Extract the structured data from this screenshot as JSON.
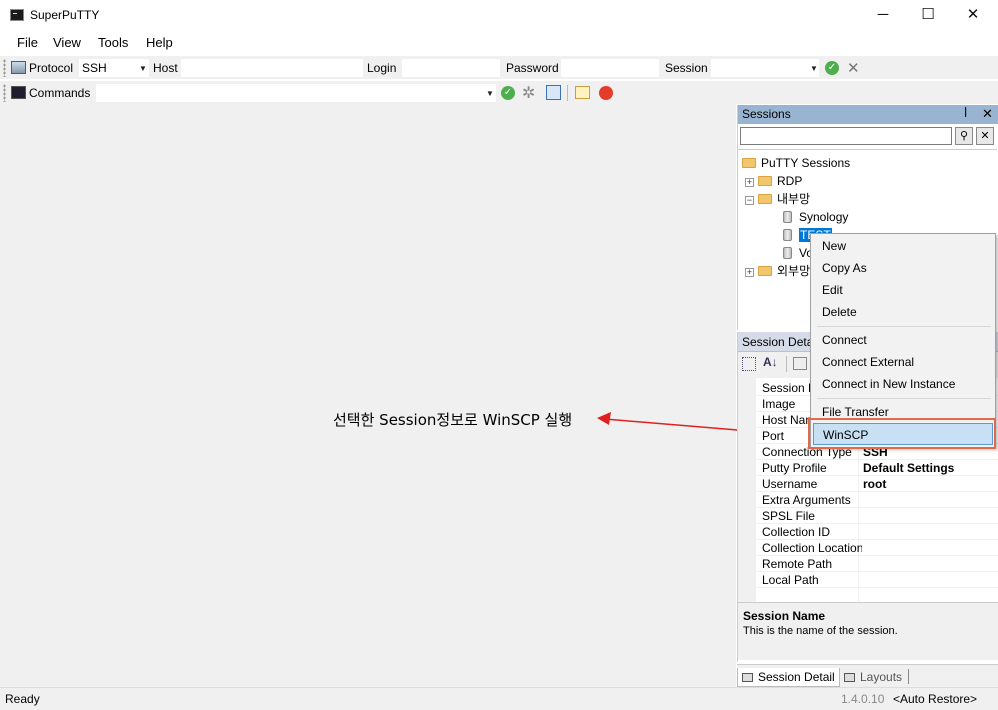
{
  "window": {
    "title": "SuperPuTTY",
    "minimize": "─",
    "maximize": "☐",
    "close": "✕"
  },
  "menu": {
    "file": "File",
    "view": "View",
    "tools": "Tools",
    "help": "Help"
  },
  "toolbar1": {
    "protocol_label": "Protocol",
    "protocol_value": "SSH",
    "host_label": "Host",
    "host_value": "",
    "login_label": "Login",
    "login_value": "",
    "password_label": "Password",
    "password_value": "",
    "session_label": "Session",
    "session_value": ""
  },
  "toolbar2": {
    "commands_label": "Commands",
    "commands_value": ""
  },
  "annotation": {
    "text": "선택한 Session정보로 WinSCP 실행"
  },
  "sessions_panel": {
    "title": "Sessions",
    "pin": "📌",
    "close": "✕",
    "tree": {
      "root": "PuTTY Sessions",
      "rdp": "RDP",
      "internal": "내부망",
      "synology": "Synology",
      "test": "TEST",
      "v_item": "Vo",
      "external": "외부망"
    }
  },
  "detail_panel": {
    "title": "Session Detail",
    "properties": [
      {
        "name": "Session Name",
        "value": ""
      },
      {
        "name": "Image",
        "value": ""
      },
      {
        "name": "Host Name",
        "value": ""
      },
      {
        "name": "Port",
        "value": ""
      },
      {
        "name": "Connection Type",
        "value": "SSH"
      },
      {
        "name": "Putty Profile",
        "value": "Default Settings"
      },
      {
        "name": "Username",
        "value": "root"
      },
      {
        "name": "Extra Arguments",
        "value": ""
      },
      {
        "name": "SPSL File",
        "value": ""
      },
      {
        "name": "Collection ID",
        "value": ""
      },
      {
        "name": "Collection Location",
        "value": ""
      },
      {
        "name": "Remote Path",
        "value": ""
      },
      {
        "name": "Local Path",
        "value": ""
      }
    ],
    "description_title": "Session Name",
    "description_text": "This is the name of the session."
  },
  "bottom_tabs": {
    "session_detail": "Session Detail",
    "layouts": "Layouts"
  },
  "context_menu": {
    "new": "New",
    "copy_as": "Copy As",
    "edit": "Edit",
    "delete": "Delete",
    "connect": "Connect",
    "connect_external": "Connect External",
    "connect_new_instance": "Connect in New Instance",
    "file_transfer": "File Transfer",
    "winscp": "WinSCP"
  },
  "status": {
    "ready": "Ready",
    "version": "1.4.0.10",
    "auto_restore": "<Auto Restore>"
  },
  "colors": {
    "accent": "#0078d7",
    "panel_header": "#99b4d1",
    "highlight_border": "#e06a4b",
    "arrow": "#e02020"
  }
}
